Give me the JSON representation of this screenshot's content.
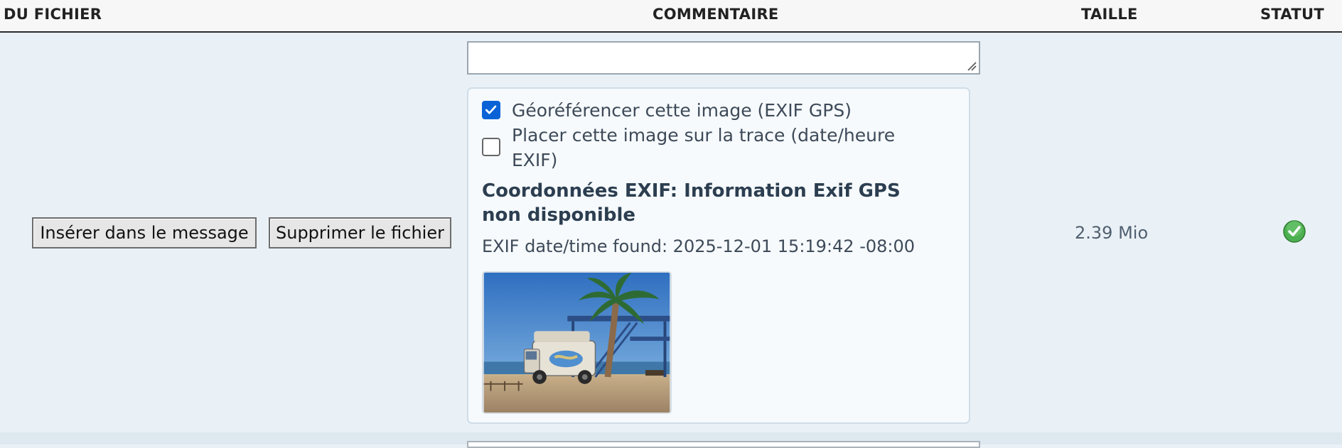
{
  "header": {
    "file_col": "DU FICHIER",
    "comment_col": "COMMENTAIRE",
    "size_col": "TAILLE",
    "status_col": "STATUT"
  },
  "row": {
    "insert_button": "Insérer dans le message",
    "delete_button": "Supprimer le fichier",
    "comment_value": "",
    "geo_checkbox": {
      "label": "Géoréférencer cette image (EXIF GPS)",
      "checked": true
    },
    "trace_checkbox": {
      "label": "Placer cette image sur la trace (date/heure EXIF)",
      "checked": false
    },
    "coords_text": "Coordonnées EXIF: Information Exif GPS non disponible",
    "exif_datetime": "EXIF date/time found: 2025-12-01 15:19:42 -08:00",
    "thumbnail_icon": "beach-photo-thumbnail",
    "size": "2.39 Mio",
    "status_icon": "check-circle-icon",
    "status_color": "#4caf50"
  },
  "colors": {
    "accent": "#0a63d6",
    "row_bg": "#eaf1f6"
  }
}
